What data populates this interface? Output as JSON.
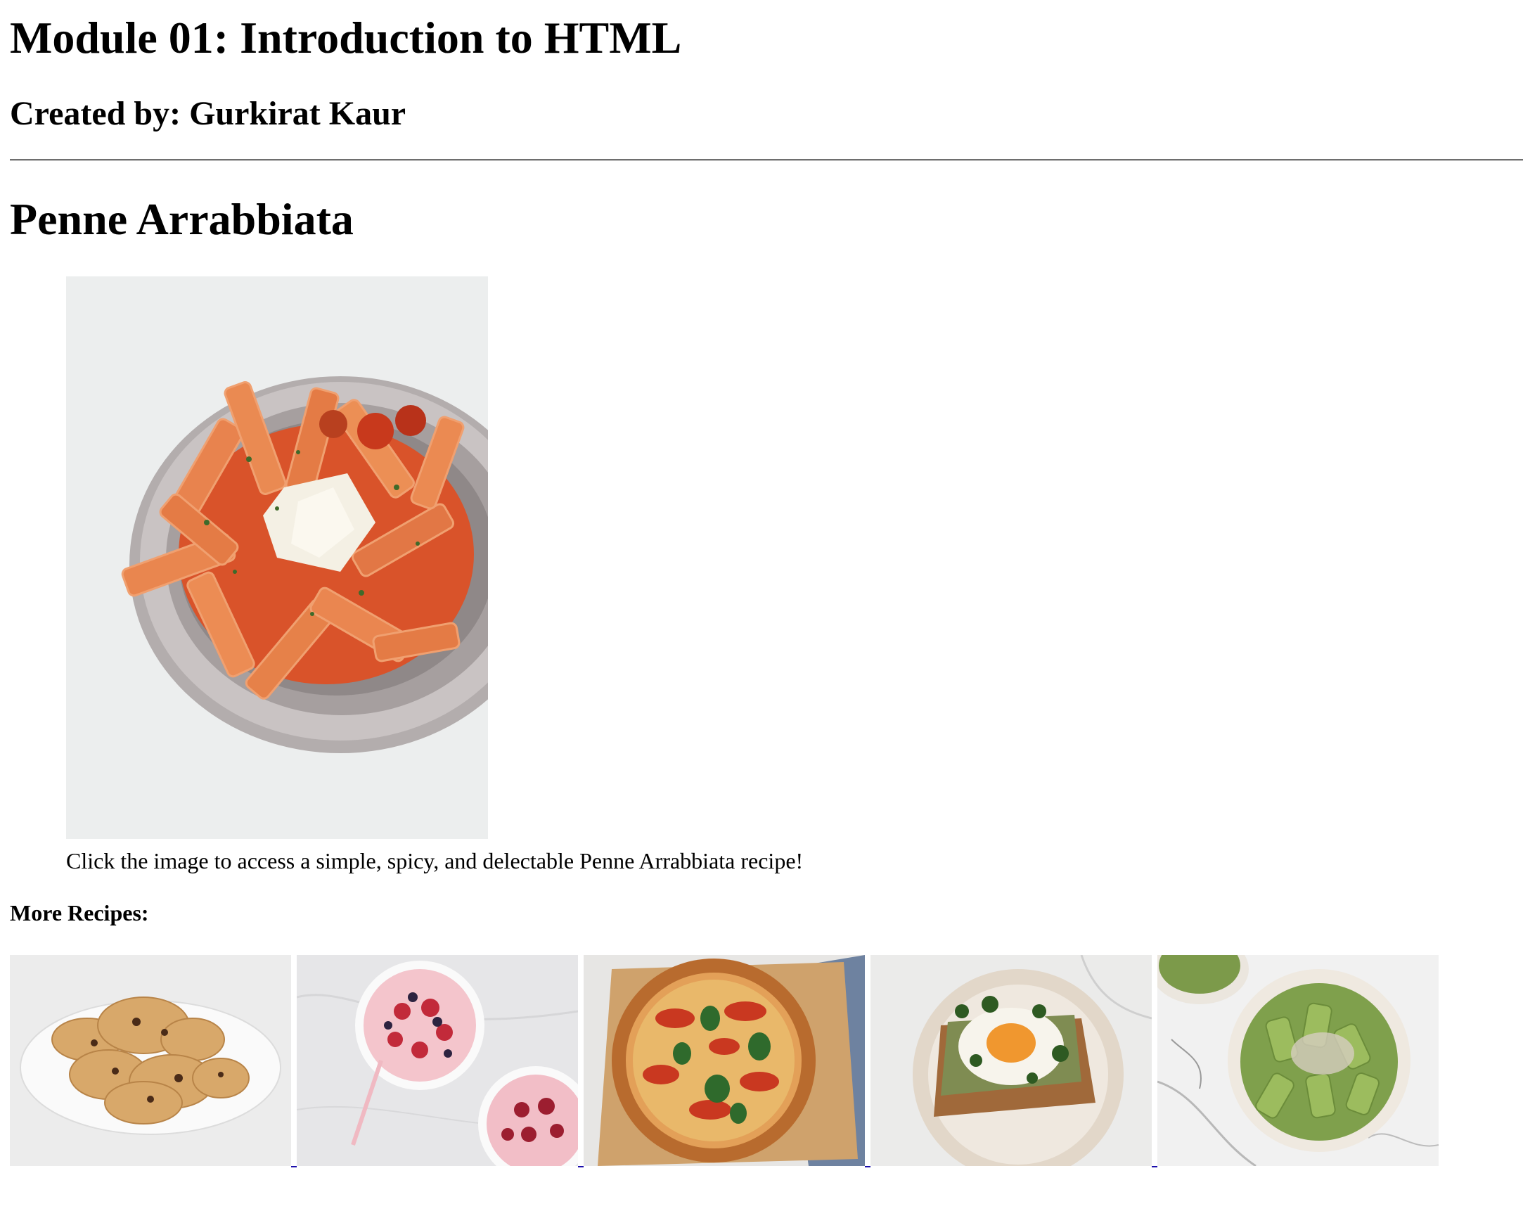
{
  "header": {
    "title": "Module 01: Introduction to HTML",
    "author": "Created by: Gurkirat Kaur"
  },
  "recipe": {
    "title": "Penne Arrabbiata",
    "image_icon": "penne-arrabbiata-photo",
    "caption": "Click the image to access a simple, spicy, and delectable Penne Arrabbiata recipe!"
  },
  "more": {
    "label": "More Recipes:",
    "items": [
      {
        "icon": "cookies-photo"
      },
      {
        "icon": "smoothie-bowl-photo"
      },
      {
        "icon": "pizza-photo"
      },
      {
        "icon": "egg-toast-photo"
      },
      {
        "icon": "pesto-pasta-photo"
      }
    ]
  },
  "colors": {
    "link_underline": "#1a0dab",
    "divider": "#6e6e6e",
    "text": "#000000"
  }
}
